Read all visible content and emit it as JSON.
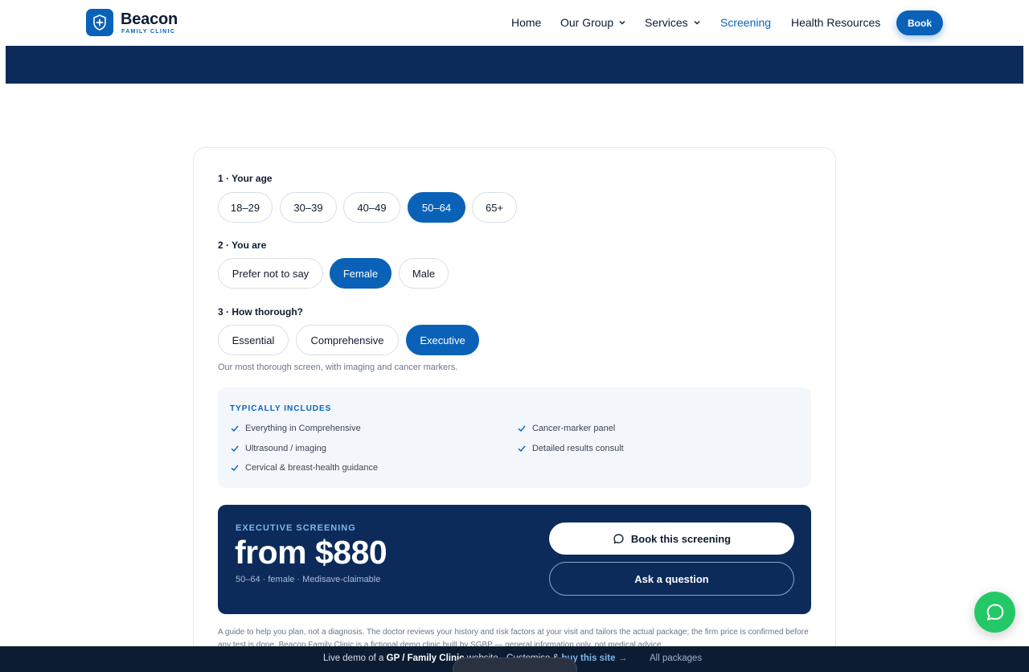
{
  "brand": {
    "name": "Beacon",
    "tagline": "FAMILY CLINIC",
    "accent": "#0a62b8",
    "navy": "#0c2b5a"
  },
  "nav": {
    "home": "Home",
    "our_group": "Our Group",
    "services": "Services",
    "screening": "Screening",
    "health_resources": "Health Resources",
    "book": "Book"
  },
  "questions": {
    "age": {
      "label": "1 · Your age",
      "options": [
        "18–29",
        "30–39",
        "40–49",
        "50–64",
        "65+"
      ],
      "selected": "50–64"
    },
    "sex": {
      "label": "2 · You are",
      "options": [
        "Prefer not to say",
        "Female",
        "Male"
      ],
      "selected": "Female"
    },
    "thoroughness": {
      "label": "3 · How thorough?",
      "options": [
        "Essential",
        "Comprehensive",
        "Executive"
      ],
      "selected": "Executive"
    }
  },
  "hint": "Our most thorough screen, with imaging and cancer markers.",
  "includes": {
    "title": "TYPICALLY INCLUDES",
    "items": [
      "Everything in Comprehensive",
      "Ultrasound / imaging",
      "Cervical & breast-health guidance",
      "Cancer-marker panel",
      "Detailed results consult"
    ]
  },
  "price": {
    "kicker": "EXECUTIVE SCREENING",
    "value": "from $880",
    "meta": "50–64 · female · Medisave-claimable",
    "book_label": "Book this screening",
    "ask_label": "Ask a question"
  },
  "disclaimer": "A guide to help you plan, not a diagnosis. The doctor reviews your history and risk factors at your visit and tailors the actual package; the firm price is confirmed before any test is done. Beacon Family Clinic is a fictional demo clinic built by SGBP — general information only, not medical advice.",
  "footer": {
    "prefix": "Live demo of a",
    "site_type": "GP / Family Clinic",
    "suffix": "website ·",
    "customise": "Customise &",
    "buy": "buy this site →",
    "all_packages": "All packages"
  }
}
